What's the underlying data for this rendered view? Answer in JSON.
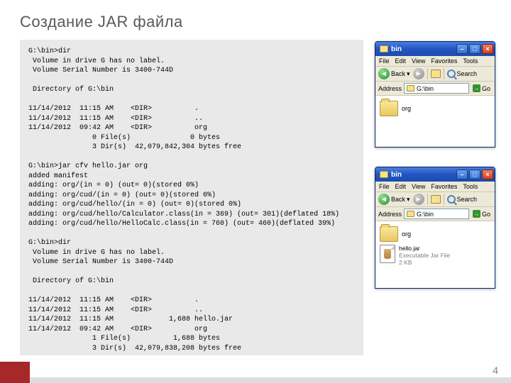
{
  "slide": {
    "title": "Создание JAR файла",
    "page_number": "4"
  },
  "console": {
    "text": "G:\\bin>dir\n Volume in drive G has no label.\n Volume Serial Number is 3400-744D\n\n Directory of G:\\bin\n\n11/14/2012  11:15 AM    <DIR>          .\n11/14/2012  11:15 AM    <DIR>          ..\n11/14/2012  09:42 AM    <DIR>          org\n               0 File(s)              0 bytes\n               3 Dir(s)  42,079,842,304 bytes free\n\nG:\\bin>jar cfv hello.jar org\nadded manifest\nadding: org/(in = 0) (out= 0)(stored 0%)\nadding: org/cud/(in = 0) (out= 0)(stored 0%)\nadding: org/cud/hello/(in = 0) (out= 0)(stored 0%)\nadding: org/cud/hello/Calculator.class(in = 369) (out= 301)(deflated 18%)\nadding: org/cud/hello/HelloCalc.class(in = 760) (out= 460)(deflated 39%)\n\nG:\\bin>dir\n Volume in drive G has no label.\n Volume Serial Number is 3400-744D\n\n Directory of G:\\bin\n\n11/14/2012  11:15 AM    <DIR>          .\n11/14/2012  11:15 AM    <DIR>          ..\n11/14/2012  11:15 AM             1,688 hello.jar\n11/14/2012  09:42 AM    <DIR>          org\n               1 File(s)          1,688 bytes\n               3 Dir(s)  42,079,838,208 bytes free\n\nG:\\bin>"
  },
  "explorer": {
    "title": "bin",
    "menu": {
      "file": "File",
      "edit": "Edit",
      "view": "View",
      "favorites": "Favorites",
      "tools": "Tools"
    },
    "toolbar": {
      "back": "Back",
      "search": "Search"
    },
    "address": {
      "label": "Address",
      "path": "G:\\bin",
      "go": "Go"
    },
    "top_items": {
      "org": "org"
    },
    "bottom_items": {
      "org": "org",
      "jar_name": "hello.jar",
      "jar_type": "Executable Jar File",
      "jar_size": "2 KB"
    }
  }
}
